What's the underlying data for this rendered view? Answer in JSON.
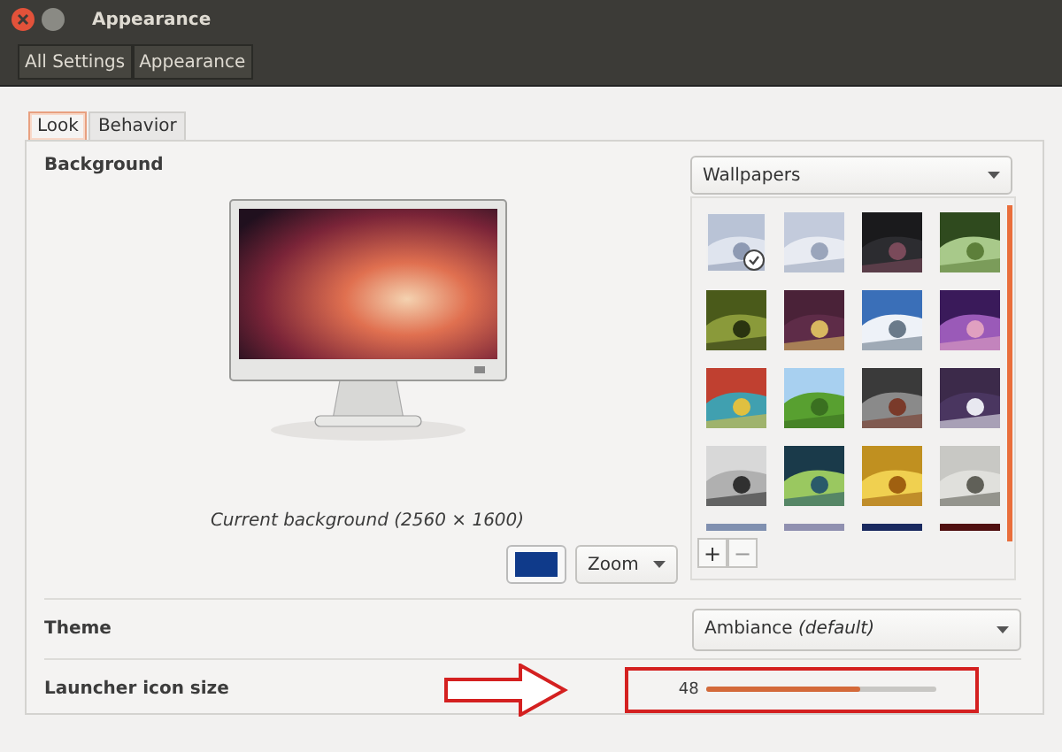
{
  "window": {
    "title": "Appearance"
  },
  "breadcrumbs": [
    "All Settings",
    "Appearance"
  ],
  "tabs": [
    {
      "label": "Look",
      "selected": true
    },
    {
      "label": "Behavior",
      "selected": false
    }
  ],
  "background": {
    "heading": "Background",
    "caption": "Current background (2560 × 1600)",
    "color": "#0f3a8a",
    "placement": "Zoom",
    "source": "Wallpapers",
    "wallpapers": [
      {
        "selected": true
      },
      {
        "selected": false
      },
      {
        "selected": false
      },
      {
        "selected": false
      },
      {
        "selected": false
      },
      {
        "selected": false
      },
      {
        "selected": false
      },
      {
        "selected": false
      },
      {
        "selected": false
      },
      {
        "selected": false
      },
      {
        "selected": false
      },
      {
        "selected": false
      },
      {
        "selected": false
      },
      {
        "selected": false
      },
      {
        "selected": false
      },
      {
        "selected": false
      },
      {
        "selected": false
      },
      {
        "selected": false
      },
      {
        "selected": false
      },
      {
        "selected": false
      }
    ],
    "add": "+",
    "remove": "−"
  },
  "theme": {
    "label": "Theme",
    "value": "Ambiance *(default)*"
  },
  "launcher": {
    "label": "Launcher icon size",
    "reading": "48",
    "level": 0.67
  }
}
